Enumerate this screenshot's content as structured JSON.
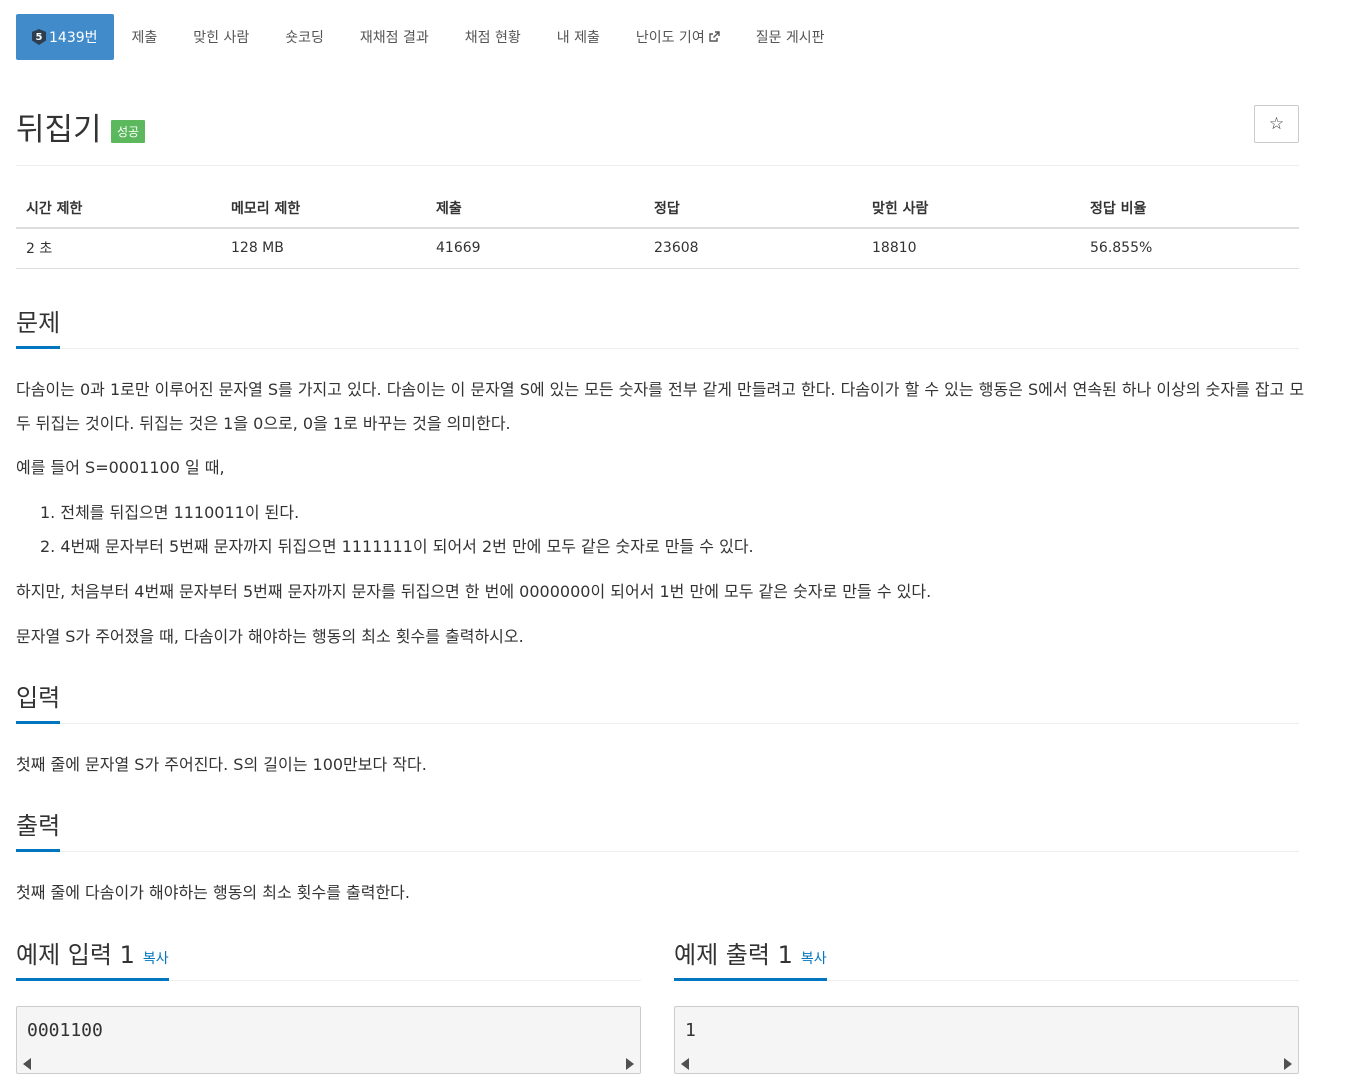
{
  "nav": {
    "tier": "5",
    "problem_label": "1439번",
    "items": [
      "제출",
      "맞힌 사람",
      "숏코딩",
      "재채점 결과",
      "채점 현황",
      "내 제출",
      "난이도 기여",
      "질문 게시판"
    ]
  },
  "problem": {
    "title": "뒤집기",
    "badge": "성공",
    "star_icon": "☆"
  },
  "info": {
    "headers": [
      "시간 제한",
      "메모리 제한",
      "제출",
      "정답",
      "맞힌 사람",
      "정답 비율"
    ],
    "values": [
      "2 초",
      "128 MB",
      "41669",
      "23608",
      "18810",
      "56.855%"
    ]
  },
  "sections": {
    "problem_heading": "문제",
    "problem_p1": "다솜이는 0과 1로만 이루어진 문자열 S를 가지고 있다. 다솜이는 이 문자열 S에 있는 모든 숫자를 전부 같게 만들려고 한다. 다솜이가 할 수 있는 행동은 S에서 연속된 하나 이상의 숫자를 잡고 모두 뒤집는 것이다. 뒤집는 것은 1을 0으로, 0을 1로 바꾸는 것을 의미한다.",
    "problem_p2": "예를 들어 S=0001100 일 때,",
    "list": [
      "1. 전체를 뒤집으면 1110011이 된다.",
      "2. 4번째 문자부터 5번째 문자까지 뒤집으면 1111111이 되어서 2번 만에 모두 같은 숫자로 만들 수 있다."
    ],
    "problem_p3": "하지만, 처음부터 4번째 문자부터 5번째 문자까지 문자를 뒤집으면 한 번에 0000000이 되어서 1번 만에 모두 같은 숫자로 만들 수 있다.",
    "problem_p4": "문자열 S가 주어졌을 때, 다솜이가 해야하는 행동의 최소 횟수를 출력하시오.",
    "input_heading": "입력",
    "input_text": "첫째 줄에 문자열 S가 주어진다. S의 길이는 100만보다 작다.",
    "output_heading": "출력",
    "output_text": "첫째 줄에 다솜이가 해야하는 행동의 최소 횟수를 출력한다."
  },
  "samples": {
    "input_heading": "예제 입력 1",
    "output_heading": "예제 출력 1",
    "copy_label": "복사",
    "input_value": "0001100",
    "output_value": "1"
  },
  "colors": {
    "primary": "#428bca",
    "success": "#5cb85c",
    "link": "#0076c0"
  }
}
